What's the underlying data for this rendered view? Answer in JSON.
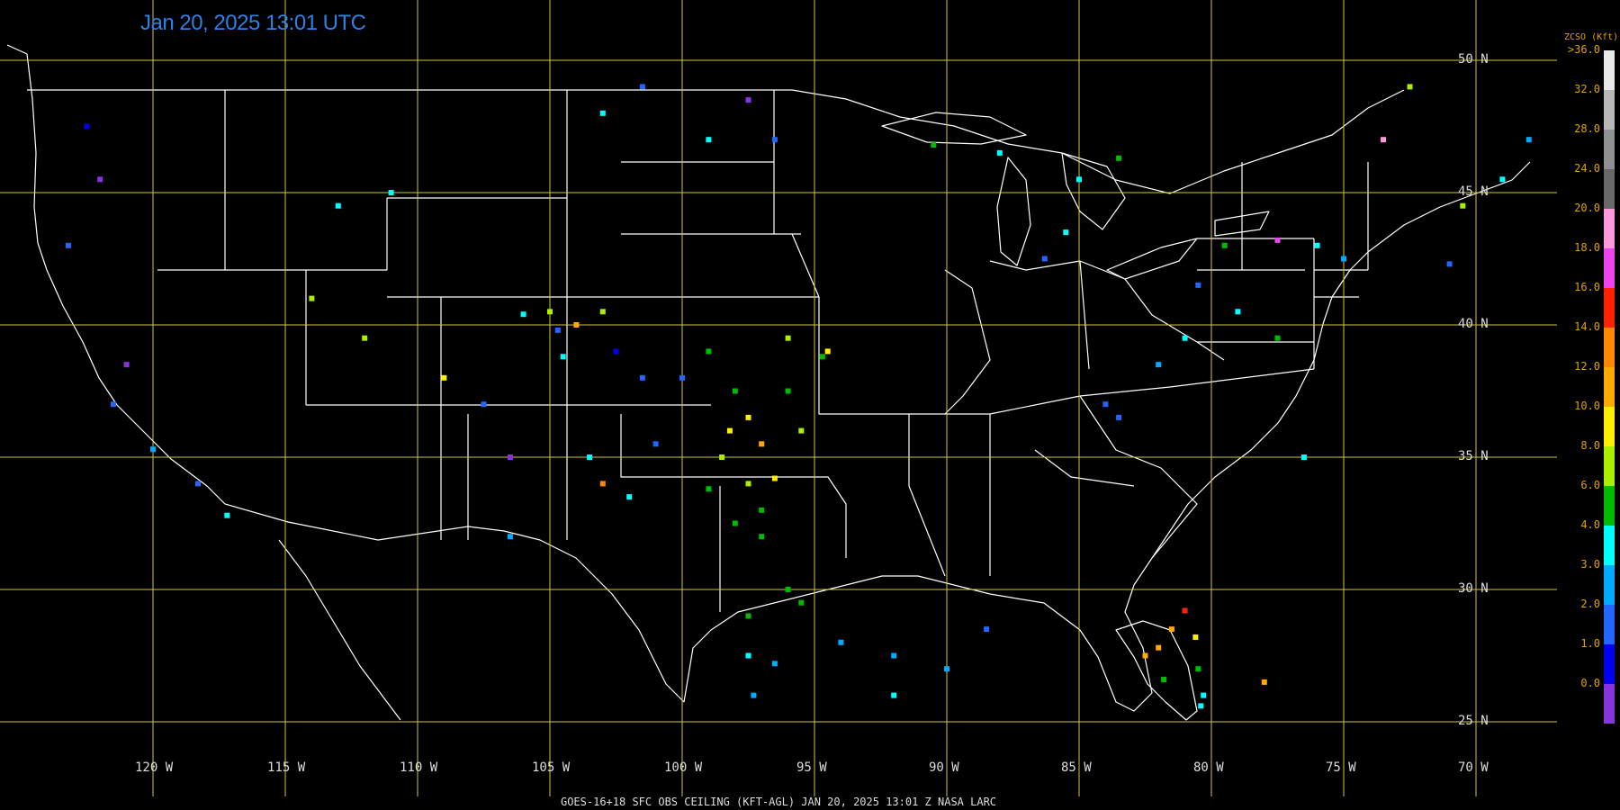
{
  "title": "Jan 20, 2025 13:01 UTC",
  "footer": "GOES-16+18  SFC OBS CEILING (KFT-AGL)   JAN 20, 2025 13:01 Z   NASA LARC",
  "latitudes": [
    {
      "label": "50 N",
      "value": 50
    },
    {
      "label": "45 N",
      "value": 45
    },
    {
      "label": "40 N",
      "value": 40
    },
    {
      "label": "35 N",
      "value": 35
    },
    {
      "label": "30 N",
      "value": 30
    },
    {
      "label": "25 N",
      "value": 25
    }
  ],
  "longitudes": [
    {
      "label": "120 W",
      "value": -120
    },
    {
      "label": "115 W",
      "value": -115
    },
    {
      "label": "110 W",
      "value": -110
    },
    {
      "label": "105 W",
      "value": -105
    },
    {
      "label": "100 W",
      "value": -100
    },
    {
      "label": "95 W",
      "value": -95
    },
    {
      "label": "90 W",
      "value": -90
    },
    {
      "label": "85 W",
      "value": -85
    },
    {
      "label": "80 W",
      "value": -80
    },
    {
      "label": "75 W",
      "value": -75
    },
    {
      "label": "70 W",
      "value": -70
    }
  ],
  "colorbar": {
    "title": "ZCSO (Kft)",
    "ticks": [
      ">36.0",
      "32.0",
      "28.0",
      "24.0",
      "20.0",
      "18.0",
      "16.0",
      "14.0",
      "12.0",
      "10.0",
      "8.0",
      "6.0",
      "4.0",
      "3.0",
      "2.0",
      "1.0",
      "0.0"
    ],
    "colors": [
      "#e8e8e8",
      "#b8b8b8",
      "#909090",
      "#686868",
      "#ff99dd",
      "#ee44ee",
      "#ff2200",
      "#ff8800",
      "#ffaa00",
      "#ffee00",
      "#aaee00",
      "#00bb00",
      "#00ffff",
      "#00aaff",
      "#2266ff",
      "#0000ee",
      "#8833dd"
    ]
  },
  "colors": {
    "grid": "#d4c63a",
    "borders": "#ffffff",
    "title": "#2f7fe6"
  },
  "chart_data": {
    "type": "scatter",
    "description_units": "longitude (deg), latitude (deg), ceiling category (kft)",
    "observations": [
      {
        "lon": -104.7,
        "lat": 39.8,
        "cat": "2.0"
      },
      {
        "lon": -104.5,
        "lat": 38.8,
        "cat": "4.0"
      },
      {
        "lon": -105.0,
        "lat": 40.5,
        "cat": "8.0"
      },
      {
        "lon": -106.0,
        "lat": 40.4,
        "cat": "4.0"
      },
      {
        "lon": -104.0,
        "lat": 40.0,
        "cat": "12.0"
      },
      {
        "lon": -103.0,
        "lat": 40.5,
        "cat": "8.0"
      },
      {
        "lon": -102.5,
        "lat": 39.0,
        "cat": "1.0"
      },
      {
        "lon": -101.5,
        "lat": 38.0,
        "cat": "2.0"
      },
      {
        "lon": -100.0,
        "lat": 38.0,
        "cat": "2.0"
      },
      {
        "lon": -99.0,
        "lat": 39.0,
        "cat": "6.0"
      },
      {
        "lon": -98.0,
        "lat": 37.5,
        "cat": "6.0"
      },
      {
        "lon": -97.5,
        "lat": 36.5,
        "cat": "10.0"
      },
      {
        "lon": -97.0,
        "lat": 35.5,
        "cat": "12.0"
      },
      {
        "lon": -97.5,
        "lat": 34.0,
        "cat": "8.0"
      },
      {
        "lon": -97.0,
        "lat": 33.0,
        "cat": "6.0"
      },
      {
        "lon": -96.5,
        "lat": 34.2,
        "cat": "10.0"
      },
      {
        "lon": -98.0,
        "lat": 32.5,
        "cat": "6.0"
      },
      {
        "lon": -97.0,
        "lat": 32.0,
        "cat": "6.0"
      },
      {
        "lon": -96.0,
        "lat": 30.0,
        "cat": "6.0"
      },
      {
        "lon": -97.5,
        "lat": 29.0,
        "cat": "6.0"
      },
      {
        "lon": -97.5,
        "lat": 27.5,
        "cat": "4.0"
      },
      {
        "lon": -97.3,
        "lat": 26.0,
        "cat": "3.0"
      },
      {
        "lon": -95.5,
        "lat": 29.5,
        "cat": "6.0"
      },
      {
        "lon": -94.5,
        "lat": 39.0,
        "cat": "10.0"
      },
      {
        "lon": -94.7,
        "lat": 38.8,
        "cat": "6.0"
      },
      {
        "lon": -96.0,
        "lat": 39.5,
        "cat": "8.0"
      },
      {
        "lon": -81.5,
        "lat": 28.5,
        "cat": "12.0"
      },
      {
        "lon": -81.0,
        "lat": 29.2,
        "cat": "16.0"
      },
      {
        "lon": -82.5,
        "lat": 27.5,
        "cat": "12.0"
      },
      {
        "lon": -82.0,
        "lat": 27.8,
        "cat": "12.0"
      },
      {
        "lon": -80.3,
        "lat": 26.0,
        "cat": "4.0"
      },
      {
        "lon": -80.4,
        "lat": 25.6,
        "cat": "4.0"
      },
      {
        "lon": -80.5,
        "lat": 27.0,
        "cat": "6.0"
      },
      {
        "lon": -81.8,
        "lat": 26.6,
        "cat": "6.0"
      },
      {
        "lon": -80.6,
        "lat": 28.2,
        "cat": "10.0"
      },
      {
        "lon": -78.0,
        "lat": 26.5,
        "cat": "12.0"
      },
      {
        "lon": -76.5,
        "lat": 35.0,
        "cat": "4.0"
      },
      {
        "lon": -85.5,
        "lat": 43.5,
        "cat": "4.0"
      },
      {
        "lon": -86.3,
        "lat": 42.5,
        "cat": "2.0"
      },
      {
        "lon": -85.0,
        "lat": 45.5,
        "cat": "4.0"
      },
      {
        "lon": -83.5,
        "lat": 46.3,
        "cat": "6.0"
      },
      {
        "lon": -79.5,
        "lat": 43.0,
        "cat": "6.0"
      },
      {
        "lon": -77.5,
        "lat": 43.2,
        "cat": "18.0"
      },
      {
        "lon": -76.0,
        "lat": 43.0,
        "cat": "4.0"
      },
      {
        "lon": -75.0,
        "lat": 42.5,
        "cat": "3.0"
      },
      {
        "lon": -71.0,
        "lat": 42.3,
        "cat": "2.0"
      },
      {
        "lon": -70.5,
        "lat": 44.5,
        "cat": "8.0"
      },
      {
        "lon": -69.0,
        "lat": 45.5,
        "cat": "4.0"
      },
      {
        "lon": -68.0,
        "lat": 47.0,
        "cat": "3.0"
      },
      {
        "lon": -72.5,
        "lat": 49.0,
        "cat": "8.0"
      },
      {
        "lon": -73.5,
        "lat": 47.0,
        "cat": "22.0"
      },
      {
        "lon": -122.5,
        "lat": 47.5,
        "cat": "1.0"
      },
      {
        "lon": -122.0,
        "lat": 45.5,
        "cat": "0.0"
      },
      {
        "lon": -123.2,
        "lat": 43.0,
        "cat": "2.0"
      },
      {
        "lon": -121.0,
        "lat": 38.5,
        "cat": "0.0"
      },
      {
        "lon": -121.5,
        "lat": 37.0,
        "cat": "2.0"
      },
      {
        "lon": -120.0,
        "lat": 35.3,
        "cat": "3.0"
      },
      {
        "lon": -118.3,
        "lat": 34.0,
        "cat": "2.0"
      },
      {
        "lon": -117.2,
        "lat": 32.8,
        "cat": "4.0"
      },
      {
        "lon": -113.0,
        "lat": 44.5,
        "cat": "4.0"
      },
      {
        "lon": -111.0,
        "lat": 45.0,
        "cat": "4.0"
      },
      {
        "lon": -114.0,
        "lat": 41.0,
        "cat": "8.0"
      },
      {
        "lon": -112.0,
        "lat": 39.5,
        "cat": "8.0"
      },
      {
        "lon": -109.0,
        "lat": 38.0,
        "cat": "10.0"
      },
      {
        "lon": -107.5,
        "lat": 37.0,
        "cat": "2.0"
      },
      {
        "lon": -106.5,
        "lat": 35.0,
        "cat": "0.0"
      },
      {
        "lon": -103.5,
        "lat": 35.0,
        "cat": "4.0"
      },
      {
        "lon": -103.0,
        "lat": 34.0,
        "cat": "14.0"
      },
      {
        "lon": -102.0,
        "lat": 33.5,
        "cat": "4.0"
      },
      {
        "lon": -101.0,
        "lat": 35.5,
        "cat": "2.0"
      },
      {
        "lon": -106.5,
        "lat": 32.0,
        "cat": "3.0"
      },
      {
        "lon": -92.0,
        "lat": 27.5,
        "cat": "3.0"
      },
      {
        "lon": -94.0,
        "lat": 28.0,
        "cat": "3.0"
      },
      {
        "lon": -90.0,
        "lat": 27.0,
        "cat": "3.0"
      },
      {
        "lon": -88.5,
        "lat": 28.5,
        "cat": "2.0"
      },
      {
        "lon": -92.0,
        "lat": 26.0,
        "cat": "4.0"
      },
      {
        "lon": -96.5,
        "lat": 27.2,
        "cat": "3.0"
      },
      {
        "lon": -84.0,
        "lat": 37.0,
        "cat": "2.0"
      },
      {
        "lon": -82.0,
        "lat": 38.5,
        "cat": "3.0"
      },
      {
        "lon": -83.5,
        "lat": 36.5,
        "cat": "2.0"
      },
      {
        "lon": -81.0,
        "lat": 39.5,
        "cat": "4.0"
      },
      {
        "lon": -79.0,
        "lat": 40.5,
        "cat": "4.0"
      },
      {
        "lon": -77.5,
        "lat": 39.5,
        "cat": "6.0"
      },
      {
        "lon": -80.5,
        "lat": 41.5,
        "cat": "2.0"
      },
      {
        "lon": -99.0,
        "lat": 47.0,
        "cat": "4.0"
      },
      {
        "lon": -97.5,
        "lat": 48.5,
        "cat": "0.0"
      },
      {
        "lon": -96.5,
        "lat": 47.0,
        "cat": "2.0"
      },
      {
        "lon": -101.5,
        "lat": 49.0,
        "cat": "2.0"
      },
      {
        "lon": -103.0,
        "lat": 48.0,
        "cat": "4.0"
      },
      {
        "lon": -88.0,
        "lat": 46.5,
        "cat": "4.0"
      },
      {
        "lon": -90.5,
        "lat": 46.8,
        "cat": "6.0"
      },
      {
        "lon": -96.0,
        "lat": 37.5,
        "cat": "6.0"
      },
      {
        "lon": -95.5,
        "lat": 36.0,
        "cat": "8.0"
      },
      {
        "lon": -98.5,
        "lat": 35.0,
        "cat": "8.0"
      },
      {
        "lon": -99.0,
        "lat": 33.8,
        "cat": "6.0"
      },
      {
        "lon": -98.2,
        "lat": 36.0,
        "cat": "10.0"
      }
    ]
  }
}
